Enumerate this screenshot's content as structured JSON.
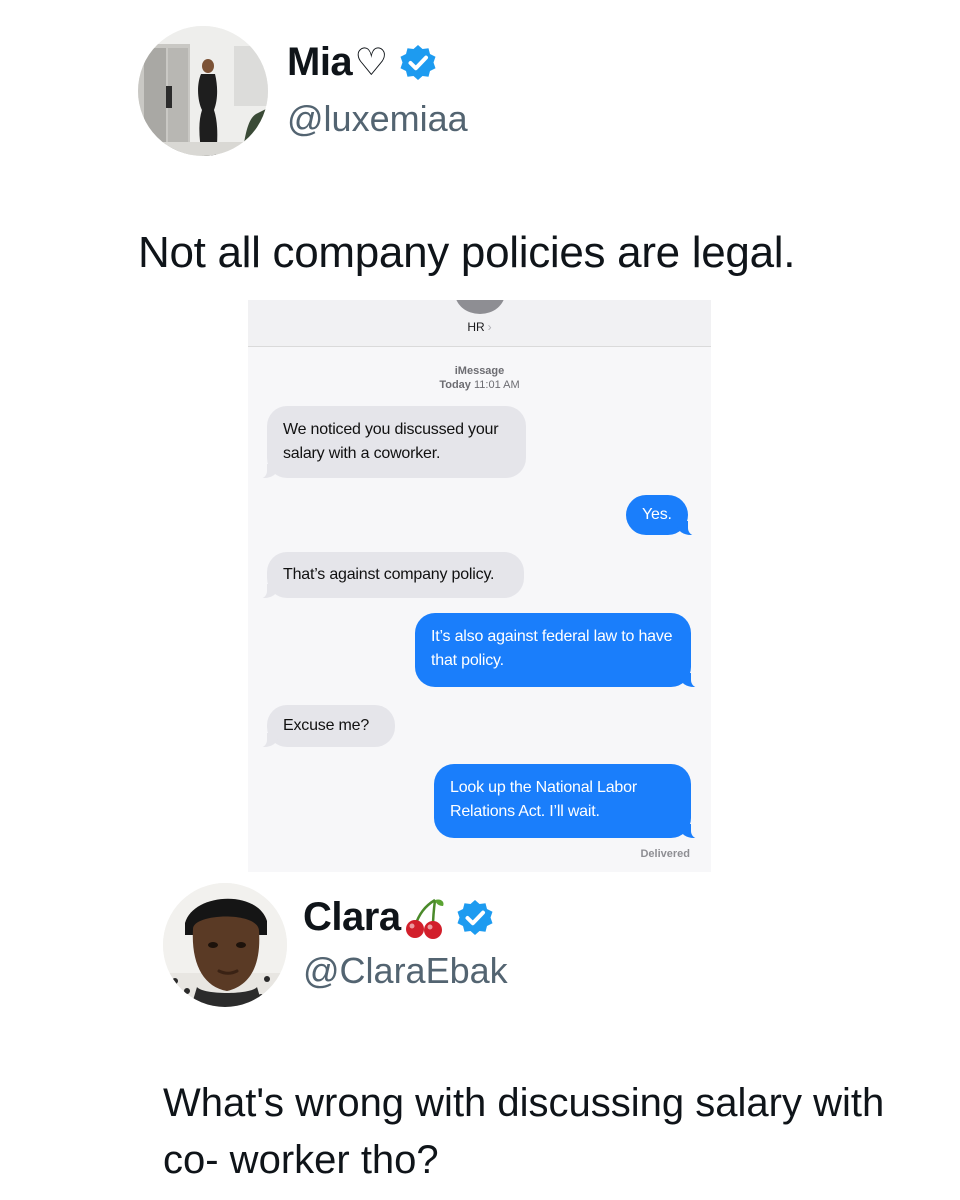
{
  "tweet_1": {
    "display_name": "Mia",
    "name_emoji": "♡",
    "handle": "@luxemiaa",
    "verified": true,
    "text": "Not all company policies are legal."
  },
  "imessage": {
    "contact_name": "HR",
    "service": "iMessage",
    "timestamp_day": "Today",
    "timestamp_time": "11:01 AM",
    "messages": [
      {
        "direction": "incoming",
        "text": "We noticed you discussed your salary with a coworker."
      },
      {
        "direction": "outgoing",
        "text": "Yes."
      },
      {
        "direction": "incoming",
        "text": "That’s against company policy."
      },
      {
        "direction": "outgoing",
        "text": "It’s also against federal law to have that policy."
      },
      {
        "direction": "incoming",
        "text": "Excuse me?"
      },
      {
        "direction": "outgoing",
        "text": "Look up the National Labor Relations Act. I’ll wait."
      }
    ],
    "delivery_status": "Delivered"
  },
  "tweet_2": {
    "display_name": "Clara",
    "name_emoji": "🍒",
    "handle": "@ClaraEbak",
    "verified": true,
    "text": "What's wrong with discussing salary with co- worker tho?"
  },
  "colors": {
    "verified_badge": "#1d9bf0",
    "imessage_blue": "#1a7efb",
    "imessage_gray": "#e5e5ea",
    "handle_gray": "#536471"
  },
  "icons": [
    "profile-photo",
    "verified-badge-icon",
    "heart-outline-icon",
    "cherries-icon",
    "chevron-right-icon"
  ]
}
